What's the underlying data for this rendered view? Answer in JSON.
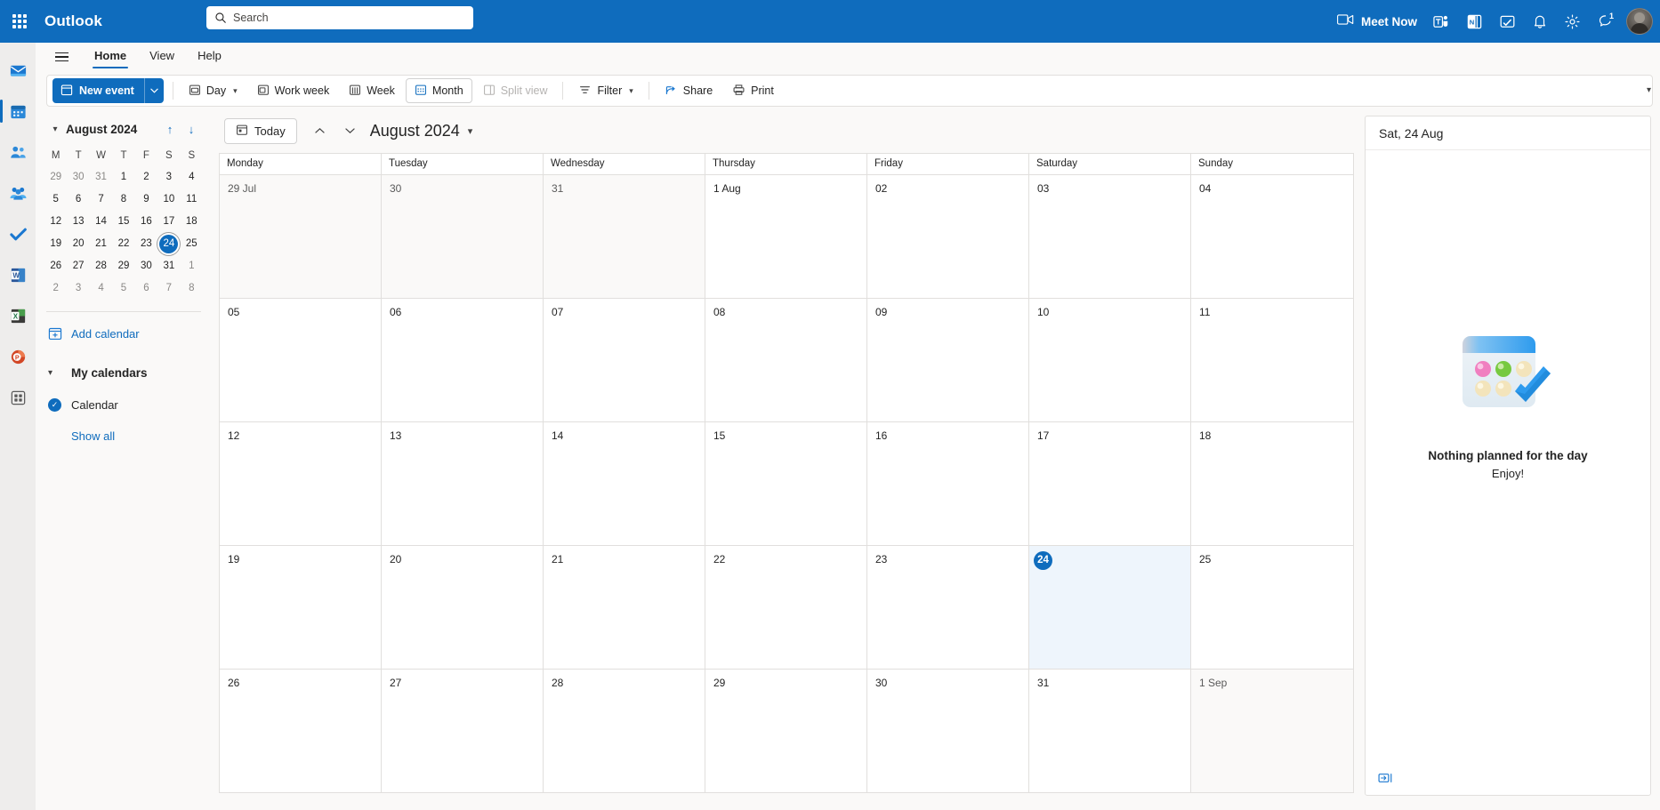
{
  "topbar": {
    "waffle_label": "app-launcher",
    "brand": "Outlook",
    "search_placeholder": "Search",
    "search_value": "",
    "meet_now": "Meet Now",
    "notification_badge": "1",
    "icons": [
      "teams-icon",
      "onenote-icon",
      "notes-icon",
      "bell-icon",
      "gear-icon",
      "feedback-icon"
    ]
  },
  "rail": {
    "items": [
      {
        "name": "mail-app-icon",
        "label": "Mail"
      },
      {
        "name": "calendar-app-icon",
        "label": "Calendar"
      },
      {
        "name": "people-app-icon",
        "label": "People"
      },
      {
        "name": "groups-app-icon",
        "label": "Groups"
      },
      {
        "name": "todo-app-icon",
        "label": "To Do"
      },
      {
        "name": "word-app-icon",
        "label": "Word"
      },
      {
        "name": "excel-app-icon",
        "label": "Excel"
      },
      {
        "name": "powerpoint-app-icon",
        "label": "PowerPoint"
      },
      {
        "name": "all-apps-icon",
        "label": "All apps"
      }
    ]
  },
  "ribbon": {
    "tabs": [
      {
        "label": "Home",
        "active": true
      },
      {
        "label": "View",
        "active": false
      },
      {
        "label": "Help",
        "active": false
      }
    ],
    "new_event": "New event",
    "commands": [
      {
        "label": "Day",
        "icon": "day-view-icon",
        "caret": true,
        "selected": false,
        "disabled": false
      },
      {
        "label": "Work week",
        "icon": "work-week-view-icon",
        "caret": false,
        "selected": false,
        "disabled": false
      },
      {
        "label": "Week",
        "icon": "week-view-icon",
        "caret": false,
        "selected": false,
        "disabled": false
      },
      {
        "label": "Month",
        "icon": "month-view-icon",
        "caret": false,
        "selected": true,
        "disabled": false
      },
      {
        "label": "Split view",
        "icon": "split-view-icon",
        "caret": false,
        "selected": false,
        "disabled": true
      },
      {
        "label": "Filter",
        "icon": "filter-icon",
        "caret": true,
        "selected": false,
        "disabled": false
      },
      {
        "label": "Share",
        "icon": "share-icon",
        "caret": false,
        "selected": false,
        "disabled": false
      },
      {
        "label": "Print",
        "icon": "print-icon",
        "caret": false,
        "selected": false,
        "disabled": false
      }
    ]
  },
  "sidebar": {
    "mini_calendar": {
      "title": "August 2024",
      "dow": [
        "M",
        "T",
        "W",
        "T",
        "F",
        "S",
        "S"
      ],
      "weeks": [
        [
          {
            "d": "29",
            "o": true
          },
          {
            "d": "30",
            "o": true
          },
          {
            "d": "31",
            "o": true
          },
          {
            "d": "1"
          },
          {
            "d": "2"
          },
          {
            "d": "3"
          },
          {
            "d": "4"
          }
        ],
        [
          {
            "d": "5"
          },
          {
            "d": "6"
          },
          {
            "d": "7"
          },
          {
            "d": "8"
          },
          {
            "d": "9"
          },
          {
            "d": "10"
          },
          {
            "d": "11"
          }
        ],
        [
          {
            "d": "12"
          },
          {
            "d": "13"
          },
          {
            "d": "14"
          },
          {
            "d": "15"
          },
          {
            "d": "16"
          },
          {
            "d": "17"
          },
          {
            "d": "18"
          }
        ],
        [
          {
            "d": "19"
          },
          {
            "d": "20"
          },
          {
            "d": "21"
          },
          {
            "d": "22"
          },
          {
            "d": "23"
          },
          {
            "d": "24",
            "t": true
          },
          {
            "d": "25"
          }
        ],
        [
          {
            "d": "26"
          },
          {
            "d": "27"
          },
          {
            "d": "28"
          },
          {
            "d": "29"
          },
          {
            "d": "30"
          },
          {
            "d": "31"
          },
          {
            "d": "1",
            "o": true
          }
        ],
        [
          {
            "d": "2",
            "o": true
          },
          {
            "d": "3",
            "o": true
          },
          {
            "d": "4",
            "o": true
          },
          {
            "d": "5",
            "o": true
          },
          {
            "d": "6",
            "o": true
          },
          {
            "d": "7",
            "o": true
          },
          {
            "d": "8",
            "o": true
          }
        ]
      ]
    },
    "add_calendar": "Add calendar",
    "my_calendars": "My calendars",
    "calendar_item": "Calendar",
    "show_all": "Show all"
  },
  "calendar": {
    "today_button": "Today",
    "title": "August 2024",
    "day_headers": [
      "Monday",
      "Tuesday",
      "Wednesday",
      "Thursday",
      "Friday",
      "Saturday",
      "Sunday"
    ],
    "weeks": [
      [
        {
          "n": "29 Jul",
          "dim": true
        },
        {
          "n": "30",
          "dim": true
        },
        {
          "n": "31",
          "dim": true
        },
        {
          "n": "1 Aug"
        },
        {
          "n": "02"
        },
        {
          "n": "03"
        },
        {
          "n": "04"
        }
      ],
      [
        {
          "n": "05"
        },
        {
          "n": "06"
        },
        {
          "n": "07"
        },
        {
          "n": "08"
        },
        {
          "n": "09"
        },
        {
          "n": "10"
        },
        {
          "n": "11"
        }
      ],
      [
        {
          "n": "12"
        },
        {
          "n": "13"
        },
        {
          "n": "14"
        },
        {
          "n": "15"
        },
        {
          "n": "16"
        },
        {
          "n": "17"
        },
        {
          "n": "18"
        }
      ],
      [
        {
          "n": "19"
        },
        {
          "n": "20"
        },
        {
          "n": "21"
        },
        {
          "n": "22"
        },
        {
          "n": "23"
        },
        {
          "n": "24",
          "today": true,
          "sel": true
        },
        {
          "n": "25"
        }
      ],
      [
        {
          "n": "26"
        },
        {
          "n": "27"
        },
        {
          "n": "28"
        },
        {
          "n": "29"
        },
        {
          "n": "30"
        },
        {
          "n": "31"
        },
        {
          "n": "1 Sep",
          "dim": true
        }
      ]
    ]
  },
  "right_pane": {
    "title": "Sat, 24 Aug",
    "empty_message": "Nothing planned for the day",
    "empty_sub": "Enjoy!"
  },
  "colors": {
    "brand_blue": "#0f6cbd",
    "topbar_blue": "#0f6cbd",
    "selected_day_bg": "#eef5fc",
    "page_bg": "#faf9f8",
    "border": "#e1dfdd"
  }
}
